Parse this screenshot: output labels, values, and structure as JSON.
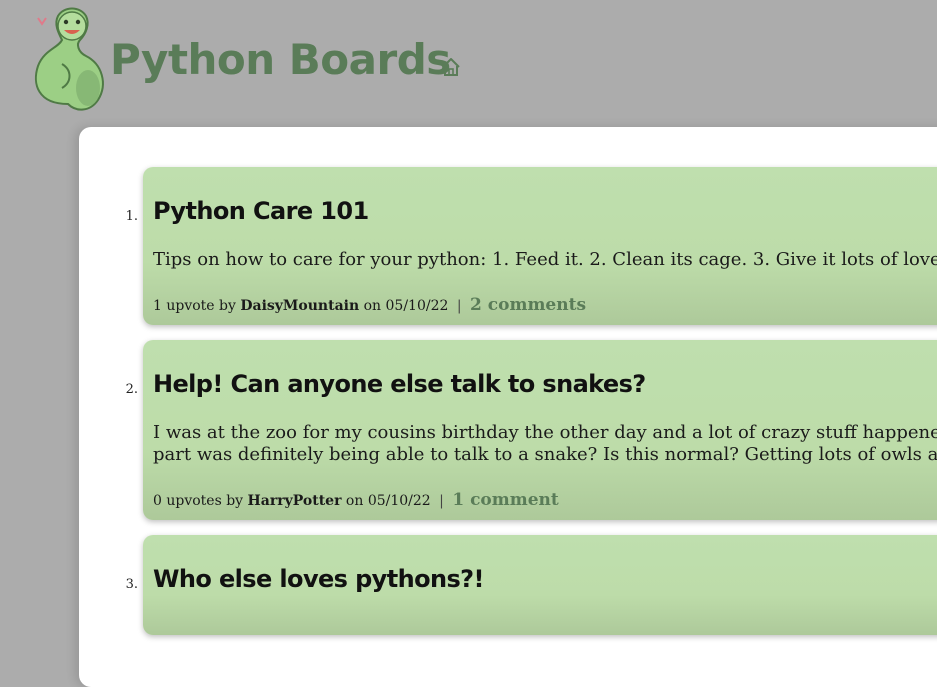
{
  "header": {
    "site_title": "Python Boards"
  },
  "posts": [
    {
      "number": "1.",
      "title": "Python Care 101",
      "body_lines": [
        "Tips on how to care for your python: 1. Feed it. 2. Clean its cage. 3. Give it lots of love!"
      ],
      "upvotes_text": "1 upvote by",
      "author": "DaisyMountain",
      "date_prefix": "on",
      "date": "05/10/22",
      "separator": "|",
      "comments": "2 comments"
    },
    {
      "number": "2.",
      "title": "Help! Can anyone else talk to snakes?",
      "body_lines": [
        "I was at the zoo for my cousins birthday the other day and a lot of crazy stuff happened b",
        "part was definitely being able to talk to a snake? Is this normal? Getting lots of owls at m"
      ],
      "upvotes_text": "0 upvotes by",
      "author": "HarryPotter",
      "date_prefix": "on",
      "date": "05/10/22",
      "separator": "|",
      "comments": "1 comment"
    },
    {
      "number": "3.",
      "title": "Who else loves pythons?!"
    }
  ],
  "colors": {
    "page_bg": "#acacac",
    "accent_green": "#5a7c58",
    "card_green": "#bfdfae"
  },
  "icons": {
    "logo": "snake-mascot-icon",
    "home": "home-icon"
  }
}
